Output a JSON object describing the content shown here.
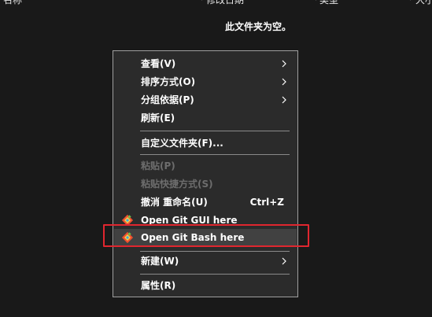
{
  "column_headers": [
    {
      "label": "名称"
    },
    {
      "label": "修改日期"
    },
    {
      "label": "类型"
    },
    {
      "label": "大小"
    }
  ],
  "empty_folder_message": "此文件夹为空。",
  "context_menu": {
    "items": [
      {
        "label": "查看(V)",
        "submenu": true
      },
      {
        "label": "排序方式(O)",
        "submenu": true
      },
      {
        "label": "分组依据(P)",
        "submenu": true
      },
      {
        "label": "刷新(E)"
      },
      {
        "label": "自定义文件夹(F)..."
      },
      {
        "label": "粘贴(P)",
        "disabled": true
      },
      {
        "label": "粘贴快捷方式(S)",
        "disabled": true
      },
      {
        "label": "撤消 重命名(U)",
        "shortcut": "Ctrl+Z"
      },
      {
        "label": "Open Git GUI here",
        "icon": "git-icon"
      },
      {
        "label": "Open Git Bash here",
        "icon": "git-icon",
        "highlighted": true
      },
      {
        "label": "新建(W)",
        "submenu": true
      },
      {
        "label": "属性(R)"
      }
    ]
  },
  "colors": {
    "background": "#191919",
    "menu_background": "#2b2b2b",
    "menu_border": "#a0a0a0",
    "hover_background": "#414141",
    "highlight_box": "#e0262f",
    "disabled_text": "#6d6d6d"
  }
}
